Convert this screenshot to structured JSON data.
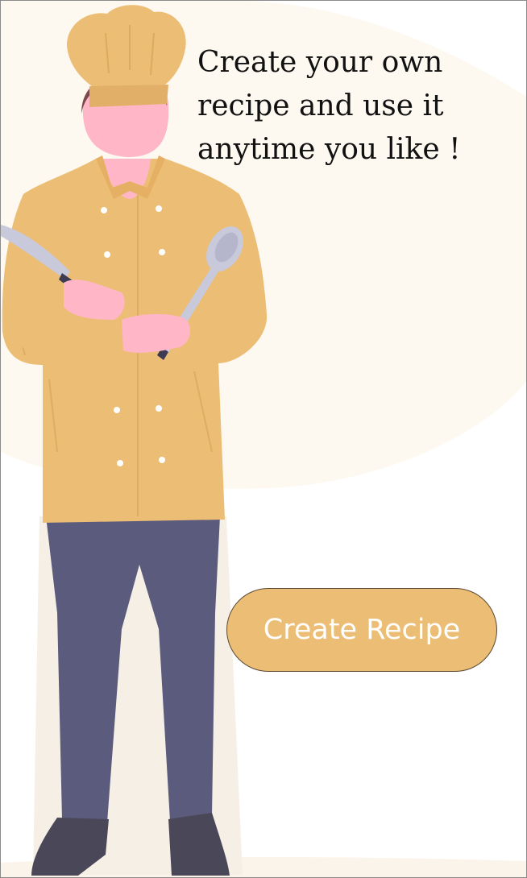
{
  "hero": {
    "headline": "Create your own\nrecipe and use it\nanytime you like !",
    "illustration": "chef-holding-knife-and-spoon"
  },
  "cta": {
    "label": "Create Recipe"
  },
  "colors": {
    "background_blob": "#fdf8f0",
    "jacket": "#ecbd74",
    "skin": "#ffb6c6",
    "hair": "#7a4a4a",
    "pants": "#5b5b7d",
    "shoes": "#4a4759",
    "utensil": "#c9c9dc",
    "button": "#ecbd74",
    "button_text": "#ffffff"
  }
}
